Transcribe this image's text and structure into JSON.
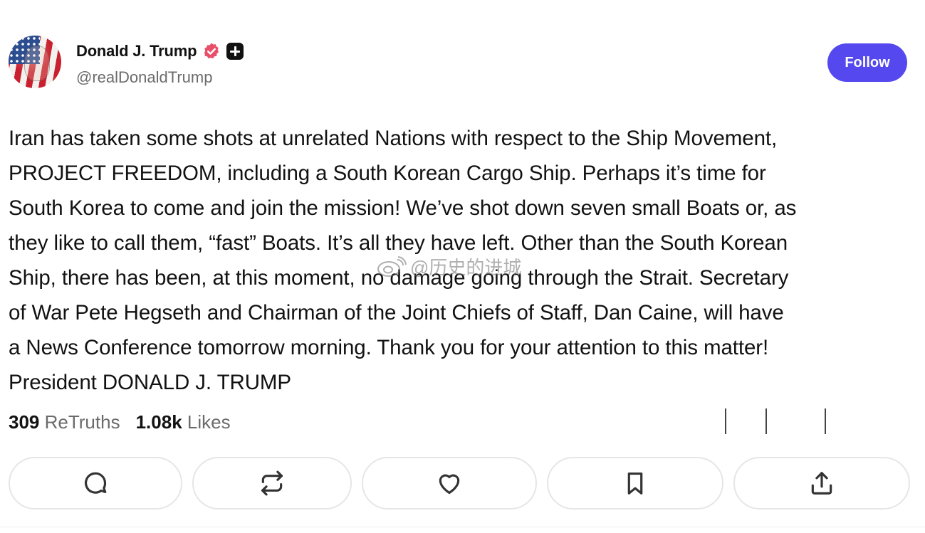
{
  "author": {
    "name": "Donald J. Trump",
    "handle": "@realDonaldTrump"
  },
  "follow_label": "Follow",
  "post": {
    "text": "Iran has taken some shots at unrelated Nations with respect to the Ship Movement,\nPROJECT FREEDOM, including a South Korean Cargo Ship. Perhaps it’s time for\nSouth Korea to come and join the mission! We’ve shot down seven small Boats or, as\nthey like to call them, “fast” Boats. It’s all they have left. Other than the South Korean\nShip, there has been, at this moment, no damage going through the Strait. Secretary\nof War Pete Hegseth and Chairman of the Joint Chiefs of Staff, Dan Caine, will have\na News Conference tomorrow morning. Thank you for your attention to this matter!\nPresident DONALD J. TRUMP"
  },
  "watermark": "@历史的进城",
  "stats": {
    "retruths_count": "309",
    "retruths_label": "ReTruths",
    "likes_count": "1.08k",
    "likes_label": "Likes"
  },
  "icons": {
    "verified": "verified-badge-icon",
    "plus": "plus-badge-icon",
    "reply": "comment-icon",
    "retruth": "repost-icon",
    "like": "heart-icon",
    "bookmark": "bookmark-icon",
    "share": "share-icon"
  },
  "colors": {
    "accent": "#5448ee",
    "verified": "#e8506a",
    "text": "#121212",
    "muted": "#6b6b6b"
  }
}
